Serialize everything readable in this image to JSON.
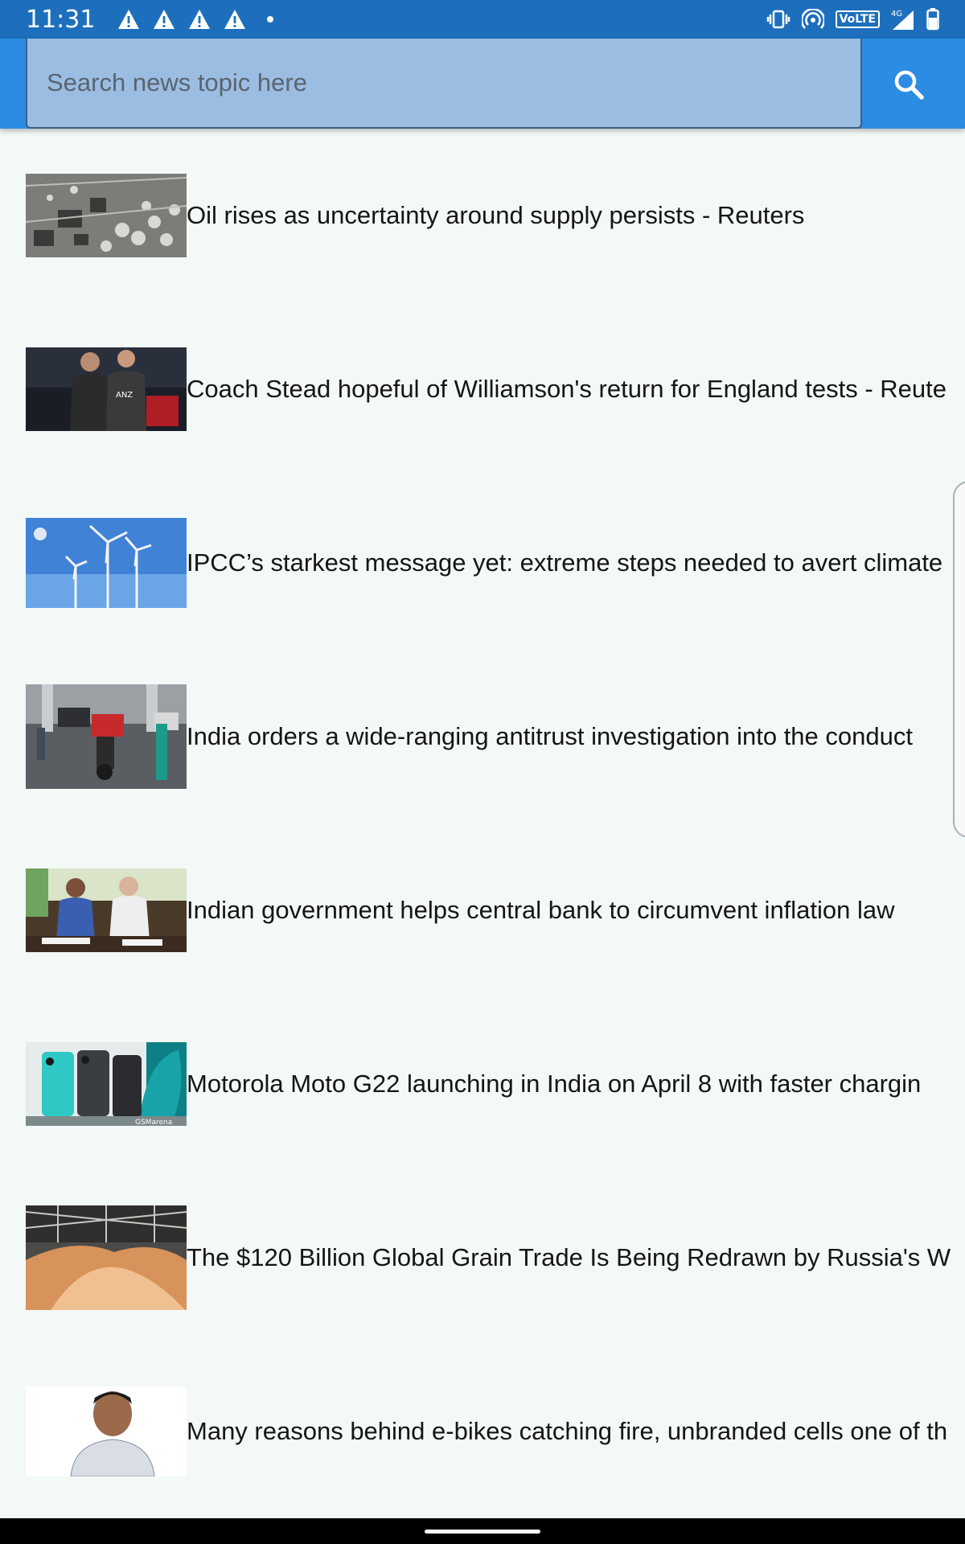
{
  "status_bar": {
    "time": "11:31",
    "warning_icons": [
      "warning-icon",
      "warning-icon",
      "warning-icon",
      "warning-icon"
    ],
    "right_icons": [
      "vibrate-icon",
      "hotspot-icon",
      "volte-icon",
      "signal-4g-icon",
      "battery-icon"
    ],
    "volte_label": "VoLTE",
    "network_label": "4G"
  },
  "search": {
    "placeholder": "Search news topic here",
    "value": "",
    "button_icon": "search-icon"
  },
  "colors": {
    "status_bar": "#1d6fbd",
    "app_bar": "#2c8be2",
    "search_box": "#9bbde2",
    "background": "#f3f9f7"
  },
  "news": [
    {
      "headline": "Oil rises as uncertainty around supply persists - Reuters",
      "thumbnail": "refinery-aerial-image"
    },
    {
      "headline": "Coach Stead hopeful of Williamson's return for England tests - Reute",
      "thumbnail": "cricket-players-image"
    },
    {
      "headline": "IPCC’s starkest message yet: extreme steps needed to avert climate",
      "thumbnail": "wind-turbines-image"
    },
    {
      "headline": "India orders a wide-ranging antitrust investigation into the conduct",
      "thumbnail": "street-scene-image"
    },
    {
      "headline": "Indian government helps central bank to circumvent inflation law",
      "thumbnail": "officials-meeting-image"
    },
    {
      "headline": "Motorola Moto G22 launching in India on April 8 with faster chargin",
      "thumbnail": "smartphones-image"
    },
    {
      "headline": "The $120 Billion Global Grain Trade Is Being Redrawn by Russia's W",
      "thumbnail": "grain-warehouse-image"
    },
    {
      "headline": "Many reasons behind e-bikes catching fire, unbranded cells one of th",
      "thumbnail": "person-portrait-image"
    }
  ]
}
